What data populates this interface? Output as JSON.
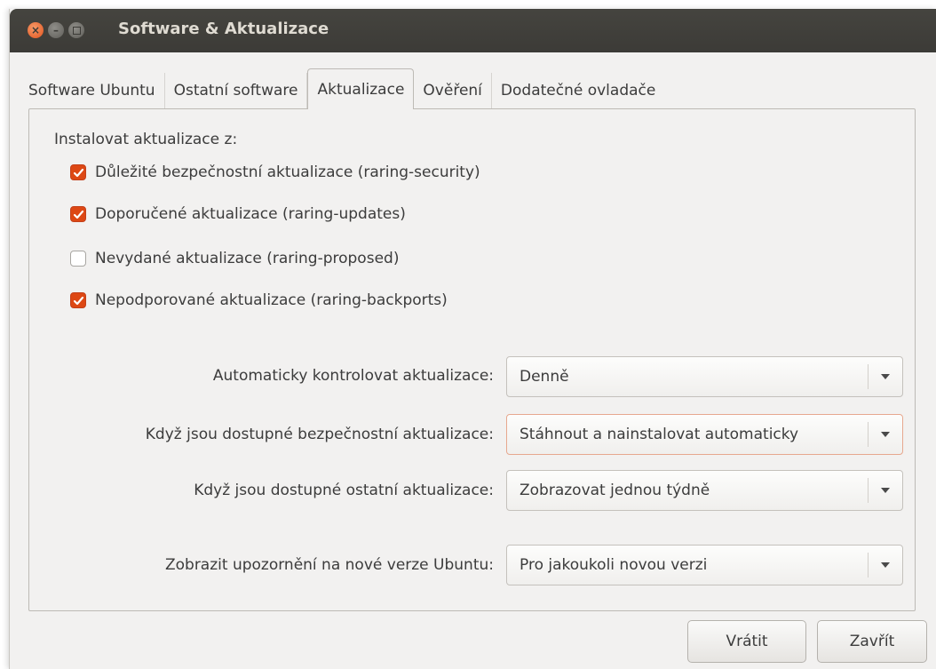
{
  "window": {
    "title": "Software & Aktualizace"
  },
  "tabs": [
    {
      "label": "Software Ubuntu"
    },
    {
      "label": "Ostatní software"
    },
    {
      "label": "Aktualizace",
      "active": true
    },
    {
      "label": "Ověření"
    },
    {
      "label": "Dodatečné ovladače"
    }
  ],
  "updates": {
    "section_label": "Instalovat aktualizace z:",
    "options": [
      {
        "label": "Důležité bezpečnostní aktualizace (raring-security)",
        "checked": true
      },
      {
        "label": "Doporučené aktualizace (raring-updates)",
        "checked": true
      },
      {
        "label": "Nevydané aktualizace (raring-proposed)",
        "checked": false
      },
      {
        "label": "Nepodporované aktualizace (raring-backports)",
        "checked": true
      }
    ]
  },
  "settings": [
    {
      "label": "Automaticky kontrolovat aktualizace:",
      "value": "Denně"
    },
    {
      "label": "Když jsou dostupné bezpečnostní aktualizace:",
      "value": "Stáhnout a nainstalovat automaticky"
    },
    {
      "label": "Když jsou dostupné ostatní aktualizace:",
      "value": "Zobrazovat jednou týdně"
    },
    {
      "label": "Zobrazit upozornění na nové verze Ubuntu:",
      "value": "Pro jakoukoli novou verzi"
    }
  ],
  "buttons": {
    "revert": "Vrátit",
    "close": "Zavřít"
  },
  "colors": {
    "accent": "#dd4814",
    "titlebar": "#3c3b37",
    "background": "#f2f1f0"
  }
}
